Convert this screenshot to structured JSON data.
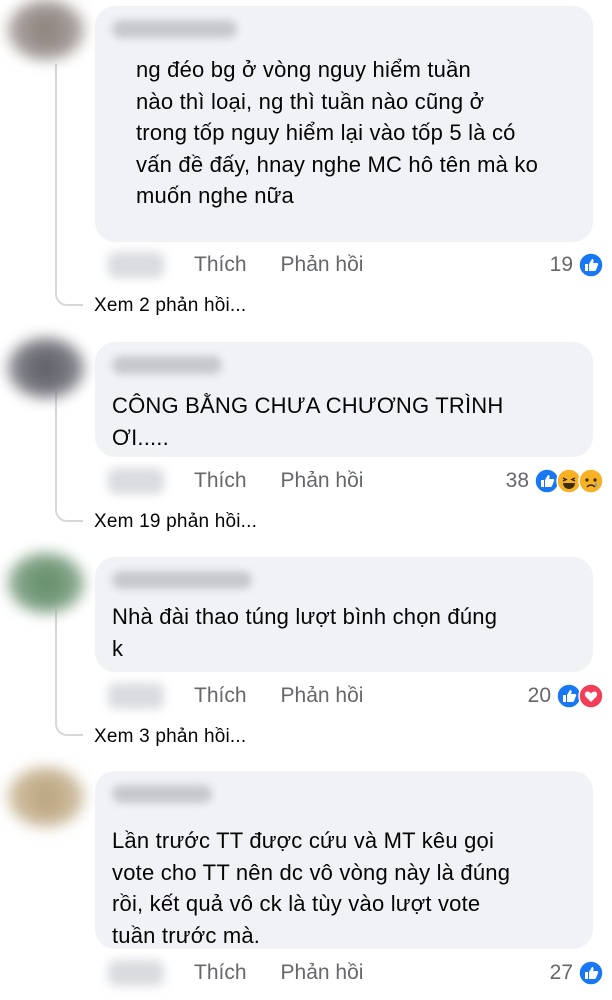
{
  "comments": [
    {
      "text": "ng đéo bg ở vòng nguy hiểm tuần\nnào thì loại, ng thì tuần nào cũng ở\ntrong tốp nguy hiểm lại vào tốp 5 là có\nvấn đề đấy, hnay nghe MC hô tên mà ko\nmuốn nghe nữa",
      "like_label": "Thích",
      "reply_label": "Phản hồi",
      "reaction_count": "19",
      "reactions": [
        "like-icon"
      ],
      "see_replies": "Xem 2 phản hồi..."
    },
    {
      "text": "CÔNG BẰNG CHƯA CHƯƠNG TRÌNH\nƠI.....",
      "like_label": "Thích",
      "reply_label": "Phản hồi",
      "reaction_count": "38",
      "reactions": [
        "like-icon",
        "haha-icon",
        "sad-icon"
      ],
      "see_replies": "Xem 19 phản hồi..."
    },
    {
      "text": "Nhà đài thao túng lượt bình chọn đúng\nk",
      "like_label": "Thích",
      "reply_label": "Phản hồi",
      "reaction_count": "20",
      "reactions": [
        "like-icon",
        "love-icon"
      ],
      "see_replies": "Xem 3 phản hồi..."
    },
    {
      "text": "Lần trước TT được cứu và MT kêu gọi\nvote cho TT nên dc vô vòng này là đúng\nrồi, kết quả vô ck là tùy vào lượt vote\ntuần trước mà.",
      "like_label": "Thích",
      "reply_label": "Phản hồi",
      "reaction_count": "27",
      "reactions": [
        "like-icon"
      ]
    }
  ],
  "colors": {
    "bubble": "#f0f2f5",
    "secondary_text": "#65676b",
    "like_blue": "#1877f2",
    "love_red": "#f33e58",
    "haha_yellow": "#f7b125"
  }
}
